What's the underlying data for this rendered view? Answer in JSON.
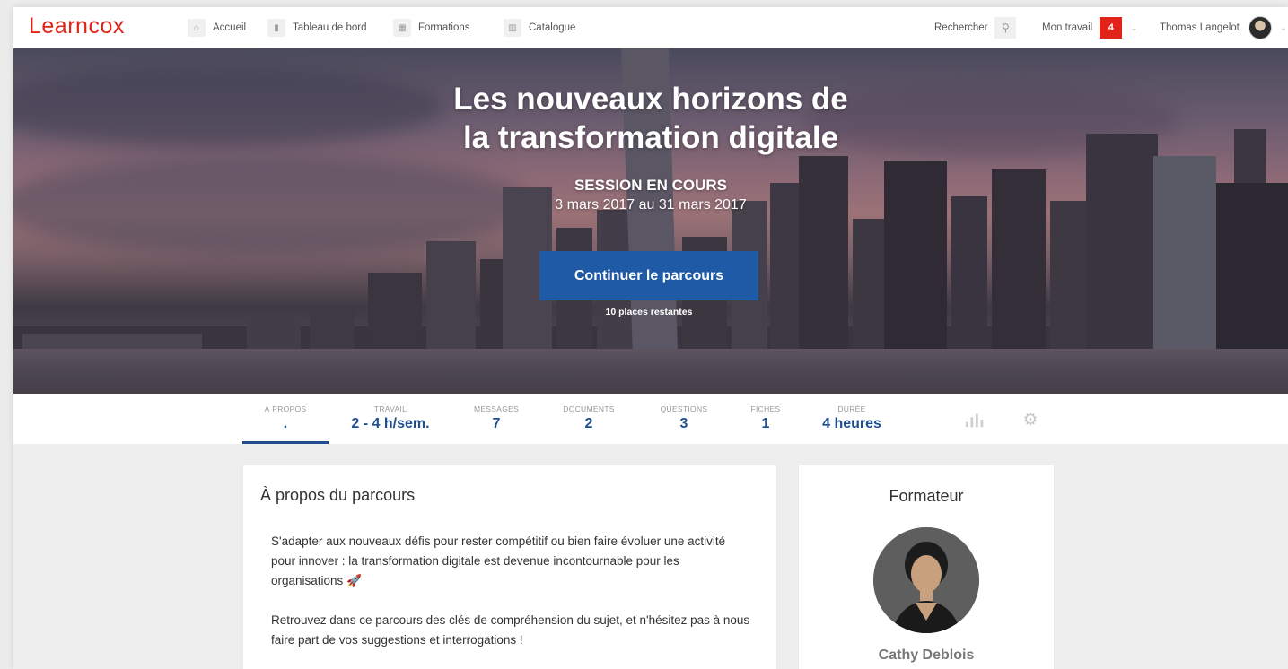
{
  "nav": {
    "logo": "Learncox",
    "items": [
      {
        "label": "Accueil",
        "icon": "home-icon"
      },
      {
        "label": "Tableau de bord",
        "icon": "bar-chart-icon"
      },
      {
        "label": "Formations",
        "icon": "grid-icon"
      },
      {
        "label": "Catalogue",
        "icon": "book-icon"
      }
    ],
    "search_label": "Rechercher",
    "work_label": "Mon travail",
    "work_count": "4",
    "user_name": "Thomas Langelot"
  },
  "hero": {
    "title_line1": "Les nouveaux horizons de",
    "title_line2": "la transformation digitale",
    "status": "SESSION EN COURS",
    "dates": "3 mars 2017 au 31 mars 2017",
    "cta": "Continuer le parcours",
    "places": "10 places restantes"
  },
  "stats": [
    {
      "label": "À PROPOS",
      "value": "."
    },
    {
      "label": "TRAVAIL",
      "value": "2 - 4 h/sem."
    },
    {
      "label": "MESSAGES",
      "value": "7"
    },
    {
      "label": "DOCUMENTS",
      "value": "2"
    },
    {
      "label": "QUESTIONS",
      "value": "3"
    },
    {
      "label": "FICHES",
      "value": "1"
    },
    {
      "label": "DURÉE",
      "value": "4 heures"
    }
  ],
  "about": {
    "title": "À propos du parcours",
    "para1": "S'adapter aux nouveaux défis pour rester compétitif ou bien faire évoluer une activité pour innover : la transformation digitale est devenue incontournable pour les organisations 🚀",
    "para2": "Retrouvez dans ce parcours des clés de compréhension du sujet, et n'hésitez pas à nous faire part de vos suggestions et interrogations !"
  },
  "trainer": {
    "title": "Formateur",
    "name": "Cathy Deblois"
  },
  "colors": {
    "brand": "#e2231a",
    "primary": "#1f5aa6",
    "stat_value": "#1f4f8f"
  }
}
